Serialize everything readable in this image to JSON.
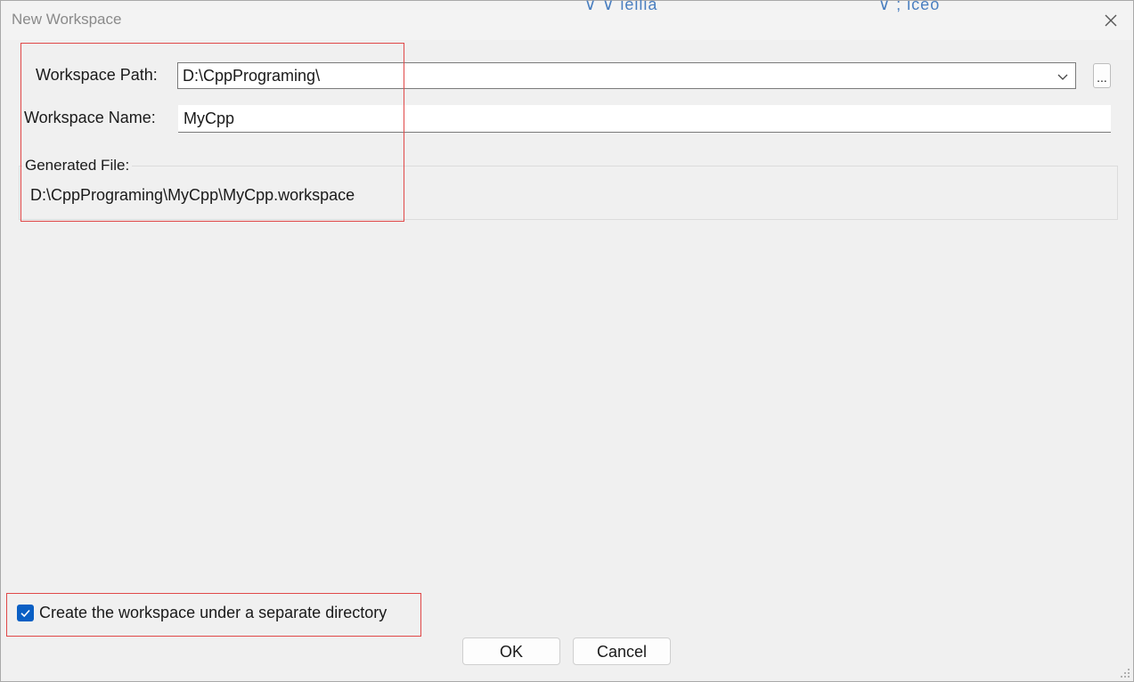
{
  "window": {
    "title": "New Workspace",
    "background_fragments": [
      "∨ ∨ ieilia",
      "∨ ; iceo"
    ]
  },
  "form": {
    "path_label": "Workspace Path:",
    "path_value": "D:\\CppPrograming\\",
    "browse_label": "...",
    "name_label": "Workspace Name:",
    "name_value": "MyCpp",
    "generated_label": "Generated File:",
    "generated_value": "D:\\CppPrograming\\MyCpp\\MyCpp.workspace"
  },
  "options": {
    "separate_dir_label": "Create the workspace under a separate directory",
    "separate_dir_checked": true
  },
  "buttons": {
    "ok": "OK",
    "cancel": "Cancel"
  },
  "icons": {
    "close": "close-icon",
    "dropdown": "chevron-down-icon",
    "check": "checkmark-icon",
    "grip": "resize-grip-icon"
  },
  "colors": {
    "annotation_border": "#e04848",
    "checkbox_fill": "#0a5fc4",
    "background": "#f0f0f0"
  }
}
